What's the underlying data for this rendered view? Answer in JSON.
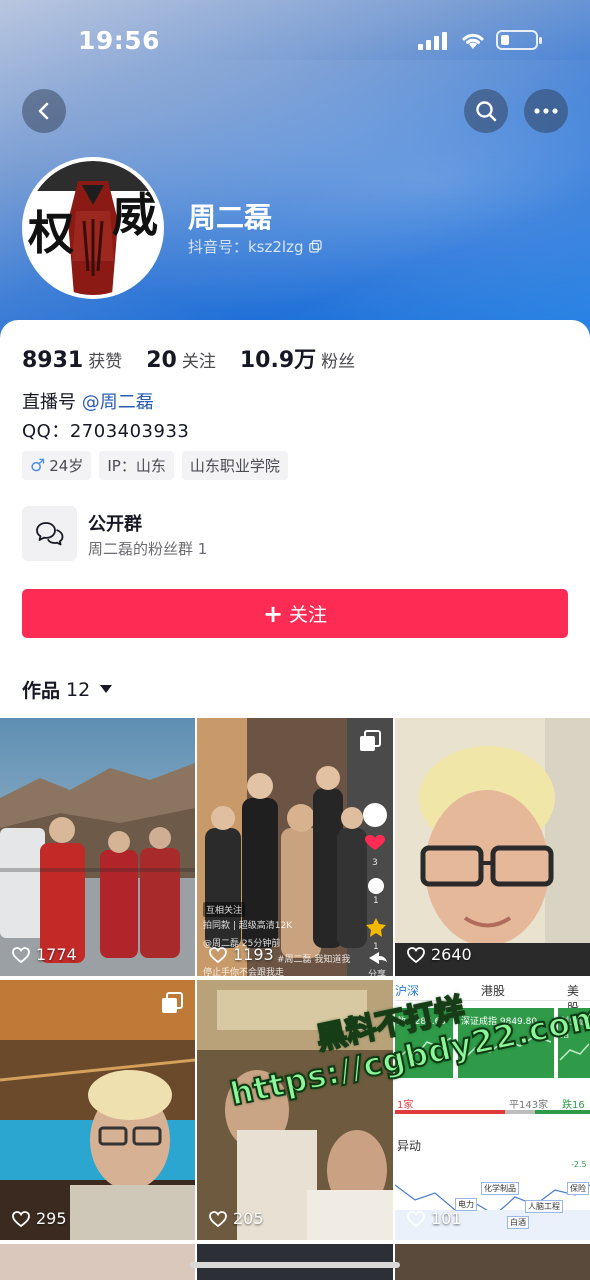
{
  "status_bar": {
    "time": "19:56"
  },
  "profile": {
    "name": "周二磊",
    "douyin_id": "抖音号：ksz2lzg",
    "avatar_text": "权威"
  },
  "stats": [
    {
      "num": "8931",
      "label": "获赞"
    },
    {
      "num": "20",
      "label": "关注"
    },
    {
      "num": "10.9万",
      "label": "粉丝"
    }
  ],
  "bio": {
    "live_prefix": "直播号",
    "live_mention": "@周二磊",
    "qq": "QQ：2703403933"
  },
  "tags": [
    {
      "icon": "male-icon",
      "symbol": "♂",
      "text": "24岁"
    },
    {
      "text": "IP：山东"
    },
    {
      "text": "山东职业学院"
    }
  ],
  "group": {
    "title": "公开群",
    "subtitle": "周二磊的粉丝群 1"
  },
  "follow_button": {
    "label": "关注"
  },
  "works_tab": {
    "label": "作品",
    "count": "12"
  },
  "videos": [
    {
      "likes": "1774"
    },
    {
      "likes": "1193",
      "overlay": [
        "互相关注",
        "拍同款 | 超级高清12K",
        "@周二磊  25分钟前",
        "#周二磊  我知道我",
        "停止手你不会跟我走"
      ],
      "side": [
        "3",
        "1",
        "1",
        "分享"
      ]
    },
    {
      "likes": "2640"
    },
    {
      "likes": "295"
    },
    {
      "likes": "205"
    },
    {
      "likes": "101",
      "market": {
        "tabs": [
          "沪深",
          "港股",
          "美股"
        ],
        "values": [
          "数 3286.65",
          "深证成指 9849.80",
          "创业板指"
        ],
        "counts": [
          "1家",
          "平143家",
          "跌16"
        ],
        "section": "异动",
        "labels": [
          "电力",
          "化学制品",
          "人脑工程",
          "保险",
          "白酒",
          "-2.5"
        ]
      }
    }
  ],
  "watermark": {
    "line1": "黑料不打烊",
    "line2": "https://cgbdy22.com"
  },
  "colors": {
    "accent": "#fe2c55",
    "mention": "#2a5db0"
  }
}
